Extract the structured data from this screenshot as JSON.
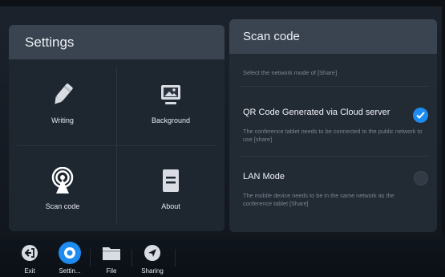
{
  "settings": {
    "title": "Settings",
    "tiles": [
      {
        "label": "Writing",
        "icon": "pen-icon"
      },
      {
        "label": "Background",
        "icon": "image-icon"
      },
      {
        "label": "Scan code",
        "icon": "broadcast-icon"
      },
      {
        "label": "About",
        "icon": "document-icon"
      }
    ]
  },
  "scan": {
    "title": "Scan code",
    "subtitle": "Select the network mode of [Share]",
    "options": [
      {
        "title": "QR Code Generated via Cloud server",
        "description": "The conference tablet needs to be connected to the public network to use [share]",
        "selected": true
      },
      {
        "title": "LAN Mode",
        "description": "The mobile device needs to be in the same network as the conference tablet [Share]",
        "selected": false
      }
    ]
  },
  "taskbar": {
    "items": [
      {
        "label": "Exit",
        "icon": "exit-icon"
      },
      {
        "label": "Settin...",
        "icon": "settings-icon",
        "active": true
      },
      {
        "label": "File",
        "icon": "folder-icon"
      },
      {
        "label": "Sharing",
        "icon": "send-icon"
      }
    ]
  },
  "colors": {
    "accent": "#1e8bf0",
    "panel_header": "#3a4350",
    "panel_bg": "#1e2630"
  }
}
